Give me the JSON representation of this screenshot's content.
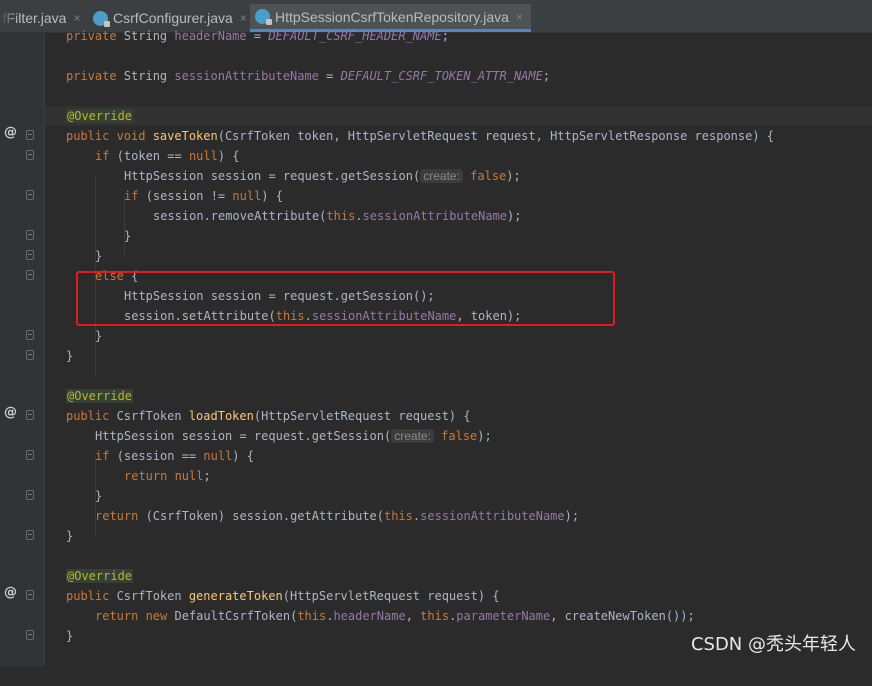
{
  "tabs": [
    {
      "label": "rfFilter.java"
    },
    {
      "label": "CsrfConfigurer.java"
    },
    {
      "label": "HttpSessionCsrfTokenRepository.java"
    }
  ],
  "tab_close_glyph": "×",
  "gutter": {
    "override_marker": "@"
  },
  "code": {
    "l1": {
      "a": "private ",
      "b": "String ",
      "c": "headerName",
      "d": " = ",
      "e": "DEFAULT_CSRF_HEADER_NAME",
      "f": ";"
    },
    "l3": {
      "a": "private ",
      "b": "String ",
      "c": "sessionAttributeName",
      "d": " = ",
      "e": "DEFAULT_CSRF_TOKEN_ATTR_NAME",
      "f": ";"
    },
    "l5": {
      "a": "@Override"
    },
    "l6": {
      "a": "public ",
      "b": "void ",
      "c": "saveToken",
      "d": "(CsrfToken token, HttpServletRequest request, HttpServletResponse response) {"
    },
    "l7": {
      "a": "if ",
      "b": "(token == ",
      "c": "null",
      "d": ") {"
    },
    "l8": {
      "a": "HttpSession session = request.getSession(",
      "hint": "create:",
      "b": "false",
      "c": ");"
    },
    "l9": {
      "a": "if ",
      "b": "(session != ",
      "c": "null",
      "d": ") {"
    },
    "l10": {
      "a": "session.removeAttribute(",
      "b": "this",
      "c": ".",
      "d": "sessionAttributeName",
      "e": ");"
    },
    "l11": {
      "a": "}"
    },
    "l12": {
      "a": "}"
    },
    "l13": {
      "a": "else ",
      "b": "{"
    },
    "l14": {
      "a": "HttpSession session = request.getSession();"
    },
    "l15": {
      "a": "session.setAttribute(",
      "b": "this",
      "c": ".",
      "d": "sessionAttributeName",
      "e": ", token);"
    },
    "l16": {
      "a": "}"
    },
    "l17": {
      "a": "}"
    },
    "l19": {
      "a": "@Override"
    },
    "l20": {
      "a": "public ",
      "b": "CsrfToken ",
      "c": "loadToken",
      "d": "(HttpServletRequest request) {"
    },
    "l21": {
      "a": "HttpSession session = request.getSession(",
      "hint": "create:",
      "b": "false",
      "c": ");"
    },
    "l22": {
      "a": "if ",
      "b": "(session == ",
      "c": "null",
      "d": ") {"
    },
    "l23": {
      "a": "return ",
      "b": "null",
      "c": ";"
    },
    "l24": {
      "a": "}"
    },
    "l25": {
      "a": "return ",
      "b": "(CsrfToken) session.getAttribute(",
      "c": "this",
      "d": ".",
      "e": "sessionAttributeName",
      "f": ");"
    },
    "l26": {
      "a": "}"
    },
    "l28": {
      "a": "@Override"
    },
    "l29": {
      "a": "public ",
      "b": "CsrfToken ",
      "c": "generateToken",
      "d": "(HttpServletRequest request) {"
    },
    "l30": {
      "a": "return ",
      "b": "new ",
      "c": "DefaultCsrfToken(",
      "d": "this",
      "e": ".",
      "f": "headerName",
      "g": ", ",
      "h": "this",
      "i": ".",
      "j": "parameterName",
      "k": ", createNewToken());"
    },
    "l31": {
      "a": "}"
    }
  },
  "watermark": "CSDN @秃头年轻人",
  "colors": {
    "keyword": "#cc7832",
    "field": "#9876aa",
    "method": "#ffc66d",
    "annotation": "#bbb529",
    "text": "#a9b7c6",
    "highlight_box": "#e01c1c",
    "background": "#2b2b2b"
  }
}
